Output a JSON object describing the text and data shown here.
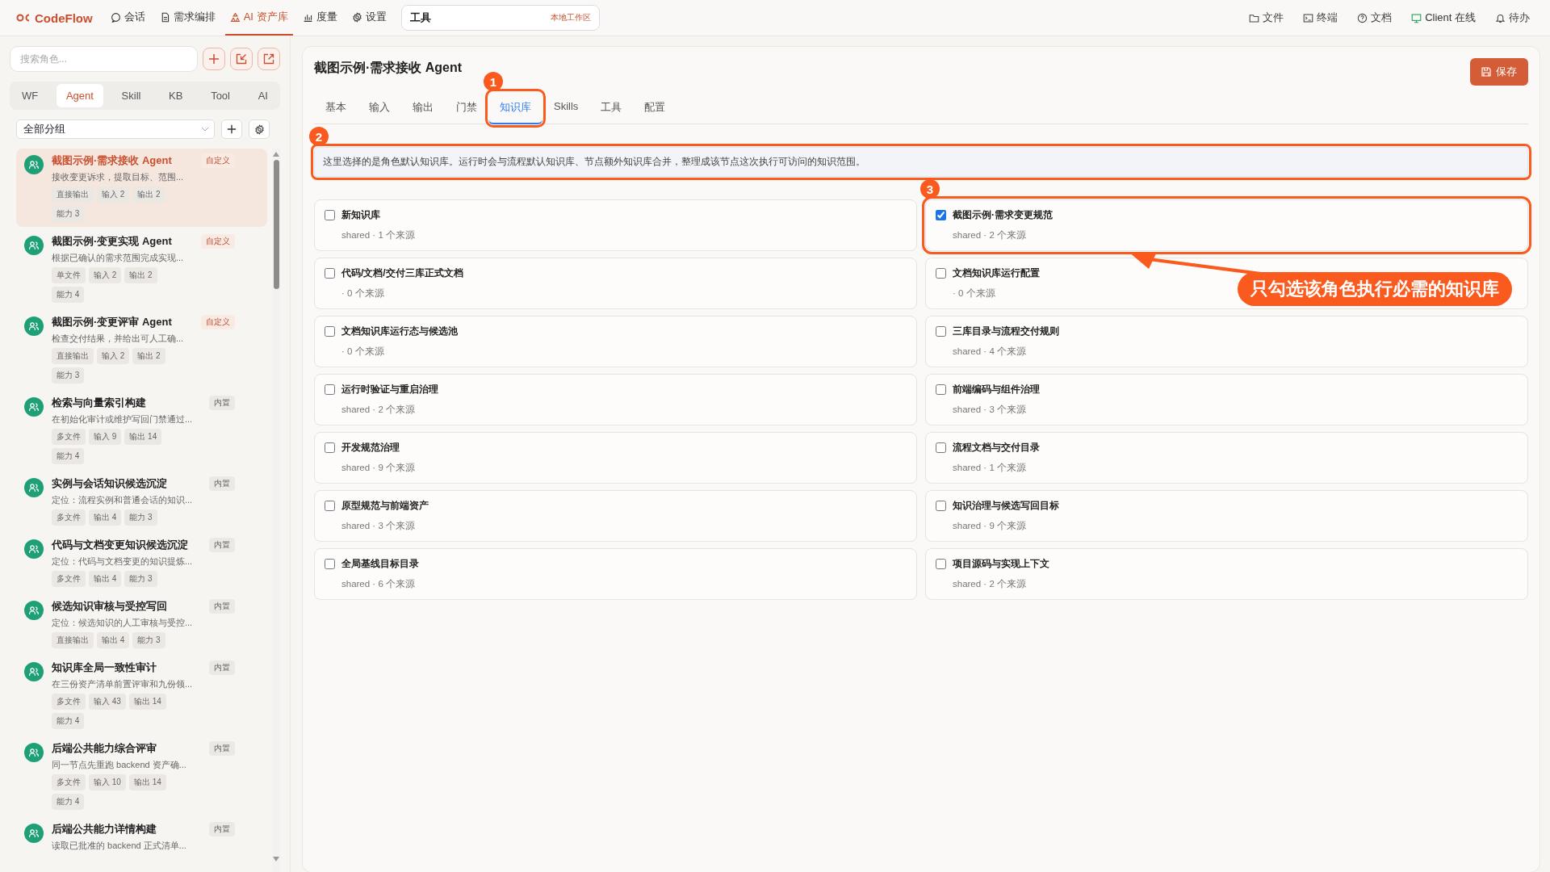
{
  "topbar": {
    "logo": "CodeFlow",
    "nav": [
      {
        "label": "会话",
        "selected": false
      },
      {
        "label": "需求编排",
        "selected": false
      },
      {
        "label": "AI 资产库",
        "selected": true
      },
      {
        "label": "度量",
        "selected": false
      },
      {
        "label": "设置",
        "selected": false
      }
    ],
    "workspace": {
      "value": "工具",
      "tag": "本地工作区"
    },
    "actions": [
      {
        "label": "文件",
        "kind": "plain"
      },
      {
        "label": "终端",
        "kind": "plain"
      },
      {
        "label": "文档",
        "kind": "plain"
      },
      {
        "label": "Client 在线",
        "kind": "status"
      },
      {
        "label": "待办",
        "kind": "plain"
      }
    ]
  },
  "sidebar": {
    "search": {
      "placeholder": "搜索角色..."
    },
    "tabs": [
      {
        "label": "WF",
        "selected": false
      },
      {
        "label": "Agent",
        "selected": true
      },
      {
        "label": "Skill",
        "selected": false
      },
      {
        "label": "KB",
        "selected": false
      },
      {
        "label": "Tool",
        "selected": false
      },
      {
        "label": "AI",
        "selected": false
      }
    ],
    "group": "全部分组",
    "items": [
      {
        "title": "截图示例·需求接收 Agent",
        "badge": "自定义",
        "kind": "custom",
        "desc": "接收变更诉求，提取目标、范围...",
        "tags": [
          "直接输出",
          "输入 2",
          "输出 2",
          "能力 3"
        ],
        "selected": true
      },
      {
        "title": "截图示例·变更实现 Agent",
        "badge": "自定义",
        "kind": "custom",
        "desc": "根据已确认的需求范围完成实现...",
        "tags": [
          "单文件",
          "输入 2",
          "输出 2",
          "能力 4"
        ],
        "selected": false
      },
      {
        "title": "截图示例·变更评审 Agent",
        "badge": "自定义",
        "kind": "custom",
        "desc": "检查交付结果，并给出可人工确...",
        "tags": [
          "直接输出",
          "输入 2",
          "输出 2",
          "能力 3"
        ],
        "selected": false
      },
      {
        "title": "检索与向量索引构建",
        "badge": "内置",
        "kind": "builtin",
        "desc": "在初始化审计或维护写回门禁通过...",
        "tags": [
          "多文件",
          "输入 9",
          "输出 14",
          "能力 4"
        ],
        "selected": false
      },
      {
        "title": "实例与会话知识候选沉淀",
        "badge": "内置",
        "kind": "builtin",
        "desc": "定位：流程实例和普通会话的知识...",
        "tags": [
          "多文件",
          "输出 4",
          "能力 3"
        ],
        "selected": false
      },
      {
        "title": "代码与文档变更知识候选沉淀",
        "badge": "内置",
        "kind": "builtin",
        "desc": "定位：代码与文档变更的知识提炼...",
        "tags": [
          "多文件",
          "输出 4",
          "能力 3"
        ],
        "selected": false
      },
      {
        "title": "候选知识审核与受控写回",
        "badge": "内置",
        "kind": "builtin",
        "desc": "定位：候选知识的人工审核与受控...",
        "tags": [
          "直接输出",
          "输出 4",
          "能力 3"
        ],
        "selected": false
      },
      {
        "title": "知识库全局一致性审计",
        "badge": "内置",
        "kind": "builtin",
        "desc": "在三份资产清单前置评审和九份领...",
        "tags": [
          "多文件",
          "输入 43",
          "输出 14",
          "能力 4"
        ],
        "selected": false
      },
      {
        "title": "后端公共能力综合评审",
        "badge": "内置",
        "kind": "builtin",
        "desc": "同一节点先重跑 backend 资产确...",
        "tags": [
          "多文件",
          "输入 10",
          "输出 14",
          "能力 4"
        ],
        "selected": false
      },
      {
        "title": "后端公共能力详情构建",
        "badge": "内置",
        "kind": "builtin",
        "desc": "读取已批准的 backend 正式清单...",
        "selected": false
      }
    ]
  },
  "main": {
    "title": "截图示例·需求接收 Agent",
    "save": "保存",
    "tabs": [
      {
        "label": "基本",
        "selected": false
      },
      {
        "label": "输入",
        "selected": false
      },
      {
        "label": "输出",
        "selected": false
      },
      {
        "label": "门禁",
        "selected": false
      },
      {
        "label": "知识库",
        "selected": true,
        "annotation": "1"
      },
      {
        "label": "Skills",
        "selected": false
      },
      {
        "label": "工具",
        "selected": false
      },
      {
        "label": "配置",
        "selected": false
      }
    ],
    "info": {
      "text": "这里选择的是角色默认知识库。运行时会与流程默认知识库、节点额外知识库合并，整理成该节点这次执行可访问的知识范围。",
      "annotation": "2"
    },
    "knowledge_bases": [
      {
        "name": "新知识库",
        "meta": "shared · 1 个来源",
        "checked": false
      },
      {
        "name": "截图示例·需求变更规范",
        "meta": "shared · 2 个来源",
        "checked": true,
        "annotation": "3"
      },
      {
        "name": "代码/文档/交付三库正式文档",
        "meta": "· 0 个来源",
        "checked": false
      },
      {
        "name": "文档知识库运行配置",
        "meta": "· 0 个来源",
        "checked": false
      },
      {
        "name": "文档知识库运行态与候选池",
        "meta": "· 0 个来源",
        "checked": false
      },
      {
        "name": "三库目录与流程交付规则",
        "meta": "shared · 4 个来源",
        "checked": false
      },
      {
        "name": "运行时验证与重启治理",
        "meta": "shared · 2 个来源",
        "checked": false
      },
      {
        "name": "前端编码与组件治理",
        "meta": "shared · 3 个来源",
        "checked": false
      },
      {
        "name": "开发规范治理",
        "meta": "shared · 9 个来源",
        "checked": false
      },
      {
        "name": "流程文档与交付目录",
        "meta": "shared · 1 个来源",
        "checked": false
      },
      {
        "name": "原型规范与前端资产",
        "meta": "shared · 3 个来源",
        "checked": false
      },
      {
        "name": "知识治理与候选写回目标",
        "meta": "shared · 9 个来源",
        "checked": false
      },
      {
        "name": "全局基线目标目录",
        "meta": "shared · 6 个来源",
        "checked": false
      },
      {
        "name": "项目源码与实现上下文",
        "meta": "shared · 2 个来源",
        "checked": false
      }
    ],
    "callout": "只勾选该角色执行必需的知识库"
  }
}
